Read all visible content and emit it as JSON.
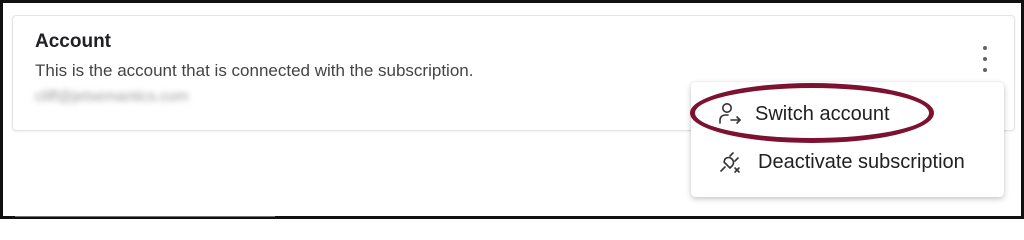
{
  "account_section": {
    "title": "Account",
    "description": "This is the account that is connected with the subscription.",
    "email": "cliff@jetsemantics.com"
  },
  "menu": {
    "items": [
      {
        "label": "Switch account",
        "icon": "switch-account-icon"
      },
      {
        "label": "Deactivate subscription",
        "icon": "deactivate-plug-icon"
      }
    ]
  },
  "colors": {
    "highlight": "#7d1230",
    "text": "#202124",
    "icon": "#5f6368"
  }
}
